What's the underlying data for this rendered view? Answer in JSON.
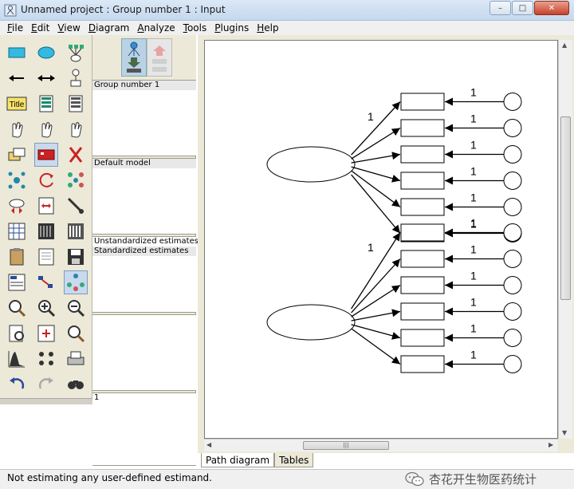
{
  "window": {
    "title": "Unnamed project : Group number 1 : Input",
    "controls": {
      "minimize": "–",
      "maximize": "□",
      "close": "✕"
    }
  },
  "menu": [
    {
      "label": "File",
      "access_key": "F"
    },
    {
      "label": "Edit",
      "access_key": "E"
    },
    {
      "label": "View",
      "access_key": "V"
    },
    {
      "label": "Diagram",
      "access_key": "D"
    },
    {
      "label": "Analyze",
      "access_key": "A"
    },
    {
      "label": "Tools",
      "access_key": "T"
    },
    {
      "label": "Plugins",
      "access_key": "P"
    },
    {
      "label": "Help",
      "access_key": "H"
    }
  ],
  "palette": {
    "title_tool_label": "Title",
    "tools": [
      "draw-observed-variable-icon",
      "draw-unobserved-variable-icon",
      "draw-latent-with-indicators-icon",
      "draw-path-icon",
      "draw-covariance-icon",
      "add-unique-variable-icon",
      "title-icon",
      "list-variables-in-model-icon",
      "list-variables-in-dataset-icon",
      "select-one-object-icon",
      "select-all-objects-icon",
      "deselect-all-objects-icon",
      "duplicate-objects-icon",
      "move-objects-icon",
      "erase-objects-icon",
      "change-shape-icon",
      "rotate-indicators-icon",
      "reflect-indicators-icon",
      "move-parameter-icon",
      "scroll-diagram-icon",
      "touch-up-variable-icon",
      "select-data-files-icon",
      "analysis-properties-icon",
      "calculate-estimates-icon",
      "copy-to-clipboard-icon",
      "view-text-icon",
      "save-diagram-icon",
      "object-properties-icon",
      "drag-properties-icon",
      "preserve-symmetries-icon",
      "zoom-in-area-icon",
      "zoom-in-icon",
      "zoom-out-icon",
      "show-whole-page-icon",
      "resize-diagram-icon",
      "magnifier-icon",
      "bayesian-estimation-icon",
      "multiple-group-analysis-icon",
      "print-diagram-icon",
      "undo-icon",
      "redo-icon",
      "specification-search-icon"
    ]
  },
  "panels": {
    "groups": [
      "Group number 1"
    ],
    "models": [
      "Default model"
    ],
    "estimates": [
      "Unstandardized estimates",
      "Standardized estimates"
    ],
    "files": [],
    "bottom": [
      "1"
    ]
  },
  "diagram": {
    "factor_loading_label": "1",
    "error_weight_label": "1",
    "factors": [
      {
        "indicators": 6,
        "fixed_loading": "1"
      },
      {
        "indicators": 6,
        "fixed_loading": "1"
      }
    ]
  },
  "tabs": [
    {
      "label": "Path diagram",
      "active": true
    },
    {
      "label": "Tables",
      "active": false
    }
  ],
  "status": {
    "text": "Not estimating any user-defined estimand.",
    "watermark": "杏花开生物医药统计"
  },
  "colors": {
    "titlebar": "#c5d8ee",
    "chrome": "#ece9d8",
    "canvas": "#ffffff",
    "ink": "#000000"
  }
}
